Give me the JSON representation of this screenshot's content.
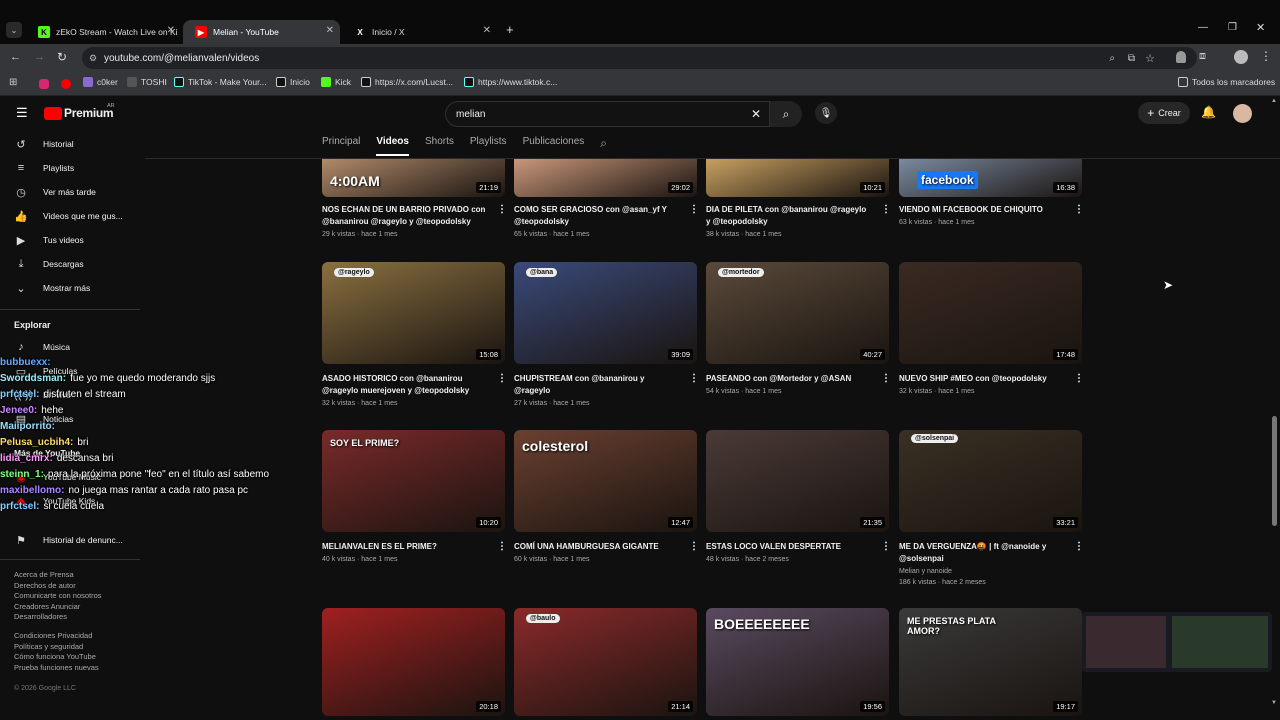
{
  "tabs": [
    {
      "label": "zEkO Stream - Watch Live on Ki",
      "icon": "K"
    },
    {
      "label": "Melian - YouTube",
      "icon": "▶"
    },
    {
      "label": "Inicio / X",
      "icon": "X"
    }
  ],
  "url": "youtube.com/@melianvalen/videos",
  "bookmarks": [
    "c0ker",
    "TOSHI",
    "TikTok - Make Your...",
    "Inicio",
    "Kick",
    "https://x.com/Lucst...",
    "https://www.tiktok.c..."
  ],
  "all_bookmarks": "Todos los marcadores",
  "yt": {
    "logo": "Premium",
    "region": "AR",
    "search_value": "melian",
    "create": "Crear"
  },
  "sidebar": {
    "items": [
      "Historial",
      "Playlists",
      "Ver más tarde",
      "Videos que me gus...",
      "Tus videos",
      "Descargas",
      "Mostrar más"
    ],
    "explore": "Explorar",
    "explore_items": [
      "Música",
      "Películas",
      "En vivo",
      "Noticias",
      "Más de YouTube",
      "YouTube Music",
      "YouTube Kids",
      "Historial de denunc..."
    ],
    "footer1": "Acerca de  Prensa",
    "footer2": "Derechos de autor",
    "footer3": "Comunicarte con nosotros",
    "footer4": "Creadores  Anunciar",
    "footer5": "Desarrolladores",
    "footer6": "Condiciones  Privacidad",
    "footer7": "Políticas y seguridad",
    "footer8": "Cómo funciona YouTube",
    "footer9": "Prueba funciones nuevas",
    "copyright": "© 2026 Google LLC"
  },
  "chat": [
    {
      "user": "bubbuexx:",
      "msg": "",
      "color": "#6af"
    },
    {
      "user": "Sworddsman:",
      "msg": "fue yo me quedo moderando sjjs",
      "color": "#9ef"
    },
    {
      "user": "prfctsel:",
      "msg": "disfruten el stream",
      "color": "#8cf"
    },
    {
      "user": "Jenee0:",
      "msg": "hehe",
      "color": "#c8f"
    },
    {
      "user": "Maiiporrito:",
      "msg": "",
      "color": "#9df"
    },
    {
      "user": "Pelusa_ucbih4:",
      "msg": "bri",
      "color": "#fd6"
    },
    {
      "user": "lidia_cmrx:",
      "msg": "descansa bri",
      "color": "#f9f"
    },
    {
      "user": "steinn_1:",
      "msg": "para la próxima pone \"feo\" en el título así sabemo",
      "color": "#8f8"
    },
    {
      "user": "maxibellomo:",
      "msg": "no juega mas rantar a cada rato pasa pc",
      "color": "#a8f"
    },
    {
      "user": "prfctsel:",
      "msg": "si cuela cuela",
      "color": "#8cf"
    }
  ],
  "nav": [
    "Principal",
    "Videos",
    "Shorts",
    "Playlists",
    "Publicaciones"
  ],
  "videos": [
    {
      "title": "NOS ECHAN DE UN BARRIO PRIVADO con @bananirou @rageylo y @teopodolsky",
      "meta": "29 k vistas · hace 1 mes",
      "dur": "21:19",
      "thumb": "4:00AM",
      "bg": "#b08a6a"
    },
    {
      "title": "COMO SER GRACIOSO con @asan_yf Y @teopodolsky",
      "meta": "65 k vistas · hace 1 mes",
      "dur": "29:02",
      "thumb": "",
      "bg": "#c9977a"
    },
    {
      "title": "DIA DE PILETA con @bananirou @rageylo y @teopodolsky",
      "meta": "38 k vistas · hace 1 mes",
      "dur": "10:21",
      "thumb": "",
      "bg": "#c7a060"
    },
    {
      "title": "VIENDO MI FACEBOOK DE CHIQUITO",
      "meta": "63 k vistas · hace 1 mes",
      "dur": "16:38",
      "thumb": "facebook",
      "bg": "#7a8aa0"
    },
    {
      "title": "ASADO HISTORICO con @bananirou @rageylo muerejoven y @teopodolsky",
      "meta": "32 k vistas · hace 1 mes",
      "dur": "15:08",
      "thumb": "@rageylo",
      "bg": "#8a7040"
    },
    {
      "title": "CHUPISTREAM con @bananirou y @rageylo",
      "meta": "27 k vistas · hace 1 mes",
      "dur": "39:09",
      "thumb": "@bana",
      "bg": "#3a4a7a"
    },
    {
      "title": "PASEANDO con @Mortedor y @ASAN",
      "meta": "54 k vistas · hace 1 mes",
      "dur": "40:27",
      "thumb": "@mortedor",
      "bg": "#5a4a3a"
    },
    {
      "title": "NUEVO SHIP #MEO con @teopodolsky",
      "meta": "32 k vistas · hace 1 mes",
      "dur": "17:48",
      "thumb": "",
      "bg": "#3a2a22"
    },
    {
      "title": "MELIANVALEN ES EL PRIME?",
      "meta": "40 k vistas · hace 1 mes",
      "dur": "10:20",
      "thumb": "SOY EL PRIME?",
      "bg": "#7a2a2a"
    },
    {
      "title": "COMÍ UNA HAMBURGUESA GIGANTE",
      "meta": "60 k vistas · hace 1 mes",
      "dur": "12:47",
      "thumb": "colesterol",
      "bg": "#6a4030"
    },
    {
      "title": "ESTAS LOCO VALEN DESPERTATE",
      "meta": "48 k vistas · hace 2 meses",
      "dur": "21:35",
      "thumb": "",
      "bg": "#4a3a38"
    },
    {
      "title": "ME DA VERGUENZA🤬 | ft @nanoide y @solsenpai",
      "sub": "Melian y nanoide",
      "meta": "186 k vistas · hace 2 meses",
      "dur": "33:21",
      "thumb": "@solsenpai",
      "bg": "#3a3024"
    },
    {
      "title": "",
      "meta": "",
      "dur": "20:18",
      "thumb": "",
      "bg": "#a02020"
    },
    {
      "title": "",
      "meta": "",
      "dur": "21:14",
      "thumb": "@baulo",
      "bg": "#8a2a2a"
    },
    {
      "title": "",
      "meta": "",
      "dur": "19:56",
      "thumb": "BOEEEEEEEE",
      "bg": "#5a4a60"
    },
    {
      "title": "",
      "meta": "",
      "dur": "19:17",
      "thumb": "ME PRESTAS PLATA AMOR?",
      "bg": "#3a3a3a"
    }
  ]
}
